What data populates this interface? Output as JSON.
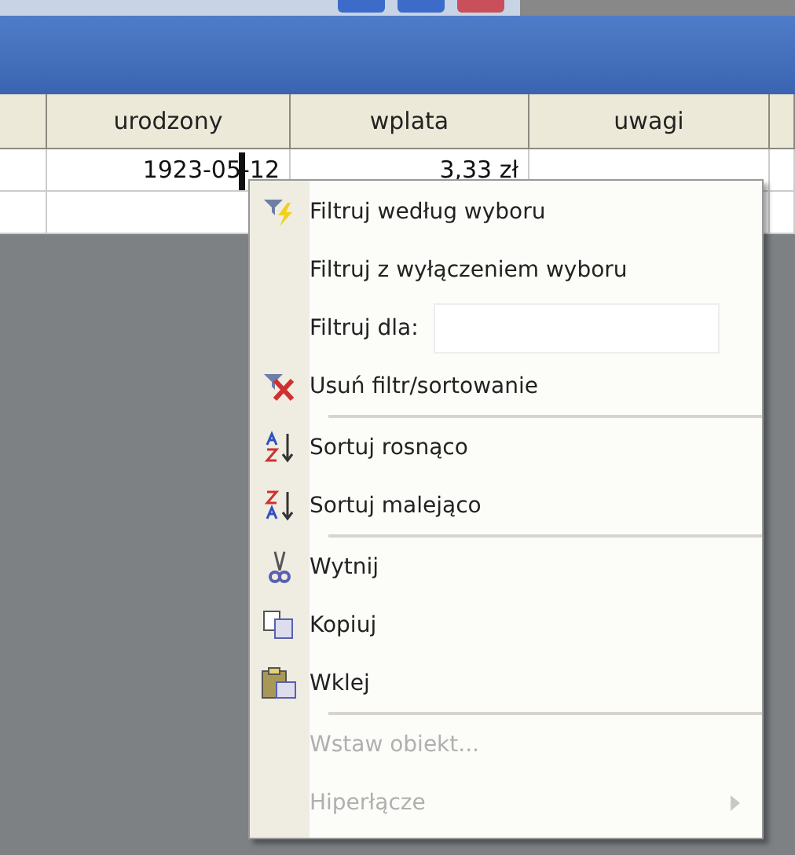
{
  "table": {
    "columns": [
      "urodzony",
      "wplata",
      "uwagi"
    ],
    "rows": [
      [
        "1923-05-12",
        "3,33 zł",
        ""
      ]
    ]
  },
  "context_menu": {
    "items": [
      {
        "kind": "item",
        "label": "Filtruj według wyboru",
        "disabled": false
      },
      {
        "kind": "item",
        "label": "Filtruj z wyłączeniem wyboru",
        "disabled": false
      },
      {
        "kind": "field",
        "label": "Filtruj dla:"
      },
      {
        "kind": "item",
        "label": "Usuń filtr/sortowanie",
        "disabled": false
      },
      {
        "kind": "separator"
      },
      {
        "kind": "item",
        "label": "Sortuj rosnąco",
        "disabled": false
      },
      {
        "kind": "item",
        "label": "Sortuj malejąco",
        "disabled": false
      },
      {
        "kind": "separator"
      },
      {
        "kind": "item",
        "label": "Wytnij",
        "disabled": false
      },
      {
        "kind": "item",
        "label": "Kopiuj",
        "disabled": false
      },
      {
        "kind": "item",
        "label": "Wklej",
        "disabled": false
      },
      {
        "kind": "separator"
      },
      {
        "kind": "item",
        "label": "Wstaw obiekt...",
        "disabled": true
      },
      {
        "kind": "submenu",
        "label": "Hiperłącze",
        "disabled": true
      }
    ]
  }
}
